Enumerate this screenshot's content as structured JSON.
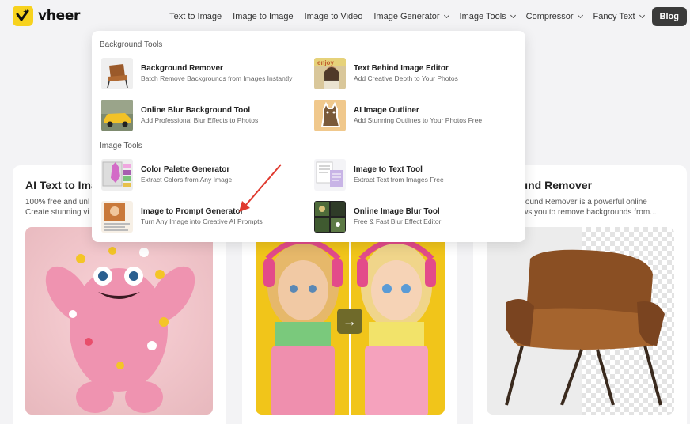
{
  "header": {
    "logo_text": "vheer",
    "nav": [
      {
        "label": "Text to Image",
        "dropdown": false
      },
      {
        "label": "Image to Image",
        "dropdown": false
      },
      {
        "label": "Image to Video",
        "dropdown": false
      },
      {
        "label": "Image Generator",
        "dropdown": true
      },
      {
        "label": "Image Tools",
        "dropdown": true
      },
      {
        "label": "Compressor",
        "dropdown": true
      },
      {
        "label": "Fancy Text",
        "dropdown": true
      }
    ],
    "blog_label": "Blog"
  },
  "dropdown": {
    "sections": [
      {
        "label": "Background Tools",
        "items": [
          {
            "title": "Background Remover",
            "subtitle": "Batch Remove Backgrounds from Images Instantly",
            "icon": "chair-thumbnail"
          },
          {
            "title": "Text Behind Image Editor",
            "subtitle": "Add Creative Depth to Your Photos",
            "icon": "portrait-text-thumbnail"
          },
          {
            "title": "Online Blur Background Tool",
            "subtitle": "Add Professional Blur Effects to Photos",
            "icon": "yellow-car-thumbnail"
          },
          {
            "title": "AI Image Outliner",
            "subtitle": "Add Stunning Outlines to Your Photos Free",
            "icon": "cat-outline-thumbnail"
          }
        ]
      },
      {
        "label": "Image Tools",
        "items": [
          {
            "title": "Color Palette Generator",
            "subtitle": "Extract Colors from Any Image",
            "icon": "palette-thumbnail"
          },
          {
            "title": "Image to Text Tool",
            "subtitle": "Extract Text from Images Free",
            "icon": "document-thumbnail"
          },
          {
            "title": "Image to Prompt Generator",
            "subtitle": "Turn Any Image into Creative AI Prompts",
            "icon": "prompt-thumbnail"
          },
          {
            "title": "Online Image Blur Tool",
            "subtitle": "Free & Fast Blur Effect Editor",
            "icon": "blur-grid-thumbnail"
          }
        ]
      }
    ]
  },
  "cards": [
    {
      "title": "AI Text to Ima",
      "desc_line1": "100% free and unl",
      "desc_line2": "Create stunning vi"
    },
    {
      "title": "",
      "desc_line1": "",
      "desc_line2": ""
    },
    {
      "title": "ound Remover",
      "desc_line1": "kground Remover is a powerful online",
      "desc_line2": "llows you to remove backgrounds from..."
    }
  ],
  "colors": {
    "accent_yellow": "#f7d21e",
    "blog_button": "#3a3a3a",
    "annotation_arrow": "#e03a2f"
  }
}
